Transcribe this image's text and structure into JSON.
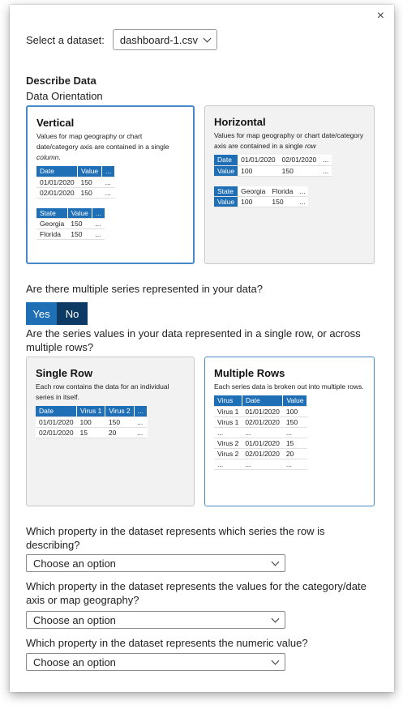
{
  "close_glyph": "×",
  "dataset": {
    "label": "Select a dataset:",
    "value": "dashboard-1.csv"
  },
  "describe": {
    "title": "Describe Data",
    "orientation_label": "Data Orientation"
  },
  "vertical": {
    "title": "Vertical",
    "desc_pre": "Values for map geography or chart date/category axis are contained in a single ",
    "desc_em": "column",
    "desc_post": ".",
    "t1": {
      "headers": [
        "Date",
        "Value",
        "..."
      ],
      "rows": [
        [
          "01/01/2020",
          "150",
          "..."
        ],
        [
          "02/01/2020",
          "150",
          "..."
        ]
      ]
    },
    "t2": {
      "headers": [
        "State",
        "Value",
        "..."
      ],
      "rows": [
        [
          "Georgia",
          "150",
          "..."
        ],
        [
          "Florida",
          "150",
          "..."
        ]
      ]
    }
  },
  "horizontal": {
    "title": "Horizontal",
    "desc_pre": "Values for map geography or chart date/category axis are contained in a single ",
    "desc_em": "row",
    "t1": {
      "rows": [
        [
          "Date",
          "01/01/2020",
          "02/01/2020",
          "..."
        ],
        [
          "Value",
          "100",
          "150",
          "..."
        ]
      ]
    },
    "t2": {
      "rows": [
        [
          "State",
          "Georgia",
          "Florida",
          "..."
        ],
        [
          "Value",
          "100",
          "150",
          "..."
        ]
      ]
    }
  },
  "multi_series": {
    "question": "Are there multiple series represented in your data?",
    "yes": "Yes",
    "no": "No"
  },
  "series_rows_question": "Are the series values in your data represented in a single row, or across multiple rows?",
  "single_row": {
    "title": "Single Row",
    "desc": "Each row contains the data for an individual series in itself.",
    "table": {
      "headers": [
        "Date",
        "Virus 1",
        "Virus 2",
        "..."
      ],
      "rows": [
        [
          "01/01/2020",
          "100",
          "150",
          "..."
        ],
        [
          "02/01/2020",
          "15",
          "20",
          "..."
        ]
      ]
    }
  },
  "multiple_rows": {
    "title": "Multiple Rows",
    "desc": "Each series data is broken out into multiple rows.",
    "table": {
      "headers": [
        "Virus",
        "Date",
        "Value"
      ],
      "rows": [
        [
          "Virus 1",
          "01/01/2020",
          "100"
        ],
        [
          "Virus 1",
          "02/01/2020",
          "150"
        ],
        [
          "...",
          "...",
          "..."
        ],
        [
          "Virus 2",
          "01/01/2020",
          "15"
        ],
        [
          "Virus 2",
          "02/01/2020",
          "20"
        ],
        [
          "...",
          "...",
          "..."
        ]
      ]
    }
  },
  "q1": {
    "label": "Which property in the dataset represents which series the row is describing?",
    "value": "Choose an option"
  },
  "q2": {
    "label": "Which property in the dataset represents the values for the category/date axis or map geography?",
    "value": "Choose an option"
  },
  "q3": {
    "label": "Which property in the dataset represents the numeric value?",
    "value": "Choose an option"
  }
}
